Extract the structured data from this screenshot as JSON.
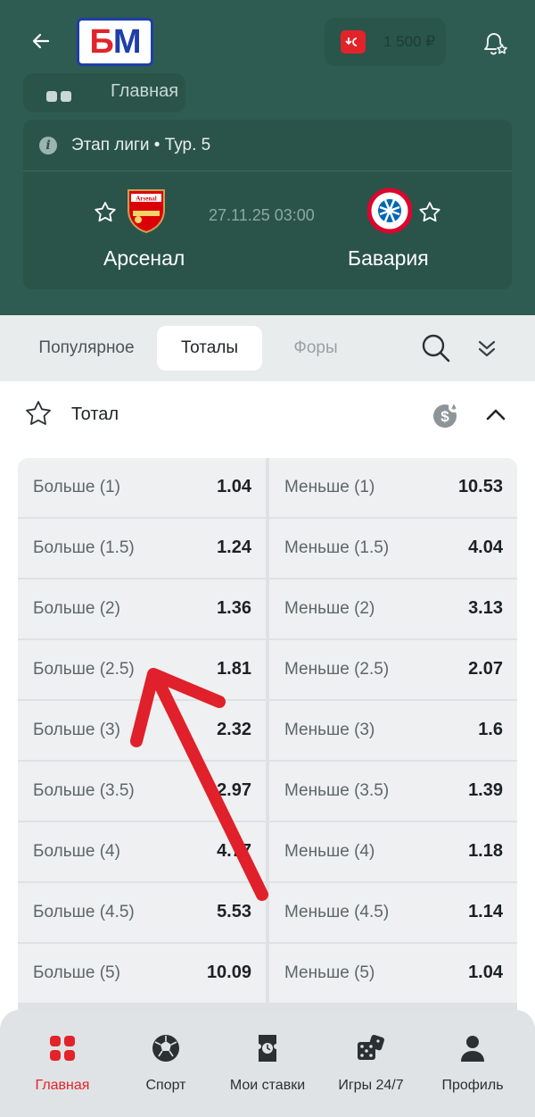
{
  "header": {
    "logo": "БМ",
    "logo_b": "Б",
    "logo_m": "М",
    "balance": "1 500 ₽",
    "section_chip": "Главная"
  },
  "match": {
    "stage": "Этап лиги • Тур. 5",
    "datetime": "27.11.25 03:00",
    "home_team": "Арсенал",
    "away_team": "Бавария"
  },
  "tabs": {
    "items": [
      {
        "label": "Популярное",
        "state": "inactive"
      },
      {
        "label": "Тоталы",
        "state": "active"
      },
      {
        "label": "Форы",
        "state": "muted"
      }
    ]
  },
  "market": {
    "title": "Тотал",
    "rows": [
      {
        "over_label": "Больше (1)",
        "over_odds": "1.04",
        "under_label": "Меньше (1)",
        "under_odds": "10.53"
      },
      {
        "over_label": "Больше (1.5)",
        "over_odds": "1.24",
        "under_label": "Меньше (1.5)",
        "under_odds": "4.04"
      },
      {
        "over_label": "Больше (2)",
        "over_odds": "1.36",
        "under_label": "Меньше (2)",
        "under_odds": "3.13"
      },
      {
        "over_label": "Больше (2.5)",
        "over_odds": "1.81",
        "under_label": "Меньше (2.5)",
        "under_odds": "2.07"
      },
      {
        "over_label": "Больше (3)",
        "over_odds": "2.32",
        "under_label": "Меньше (3)",
        "under_odds": "1.6"
      },
      {
        "over_label": "Больше (3.5)",
        "over_odds": "2.97",
        "under_label": "Меньше (3.5)",
        "under_odds": "1.39"
      },
      {
        "over_label": "Больше (4)",
        "over_odds": "4.77",
        "under_label": "Меньше (4)",
        "under_odds": "1.18"
      },
      {
        "over_label": "Больше (4.5)",
        "over_odds": "5.53",
        "under_label": "Меньше (4.5)",
        "under_odds": "1.14"
      },
      {
        "over_label": "Больше (5)",
        "over_odds": "10.09",
        "under_label": "Меньше (5)",
        "under_odds": "1.04"
      }
    ]
  },
  "bottom_nav": {
    "items": [
      {
        "label": "Главная",
        "icon": "grid-icon",
        "active": true
      },
      {
        "label": "Спорт",
        "icon": "soccer-ball-icon",
        "active": false
      },
      {
        "label": "Мои ставки",
        "icon": "ticket-clock-icon",
        "active": false
      },
      {
        "label": "Игры 24/7",
        "icon": "dice-icon",
        "active": false
      },
      {
        "label": "Профиль",
        "icon": "person-icon",
        "active": false
      }
    ]
  },
  "colors": {
    "header_bg": "#2e5c52",
    "accent_red": "#e2232a",
    "logo_blue": "#1e3ea8",
    "annotation_arrow": "#e0202a"
  }
}
